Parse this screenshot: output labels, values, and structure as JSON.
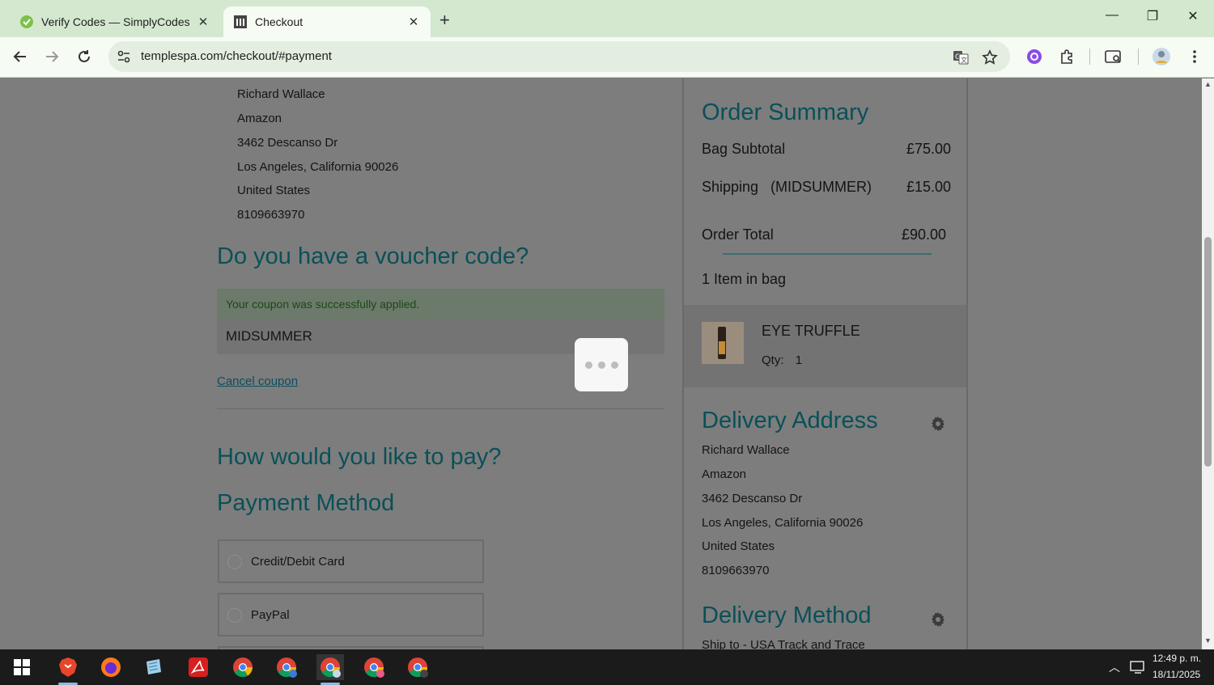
{
  "browser": {
    "tabs": [
      {
        "title": "Verify Codes — SimplyCodes",
        "active": false
      },
      {
        "title": "Checkout",
        "active": true
      }
    ],
    "url": "templespa.com/checkout/#payment"
  },
  "address": {
    "lines": [
      "Richard Wallace",
      "Amazon",
      "3462 Descanso Dr",
      "Los Angeles, California 90026",
      "United States",
      "8109663970"
    ]
  },
  "voucher": {
    "heading": "Do you have a voucher code?",
    "success_message": "Your coupon was successfully applied.",
    "code": "MIDSUMMER",
    "cancel_label": "Cancel coupon"
  },
  "payment": {
    "heading": "How would you like to pay?",
    "method_heading": "Payment Method",
    "options": [
      "Credit/Debit Card",
      "PayPal"
    ]
  },
  "summary": {
    "title": "Order Summary",
    "subtotal_label": "Bag Subtotal",
    "subtotal_value": "£75.00",
    "shipping_label": "Shipping",
    "shipping_code": "(MIDSUMMER)",
    "shipping_value": "£15.00",
    "total_label": "Order Total",
    "total_value": "£90.00",
    "items_count": "1 Item in bag",
    "item": {
      "name": "EYE TRUFFLE",
      "qty_label": "Qty:",
      "qty": "1"
    }
  },
  "delivery": {
    "title": "Delivery Address",
    "lines": [
      "Richard Wallace",
      "Amazon",
      "3462 Descanso Dr",
      "Los Angeles, California 90026",
      "United States",
      "8109663970"
    ],
    "method_title": "Delivery Method",
    "method_text": "Ship to - USA Track and Trace"
  },
  "taskbar": {
    "time": "12:49 p. m.",
    "date": "18/11/2025"
  },
  "colors": {
    "heading": "#0a5058",
    "tabbar": "#d3e8cf",
    "overlay": "#7d7d7d"
  }
}
